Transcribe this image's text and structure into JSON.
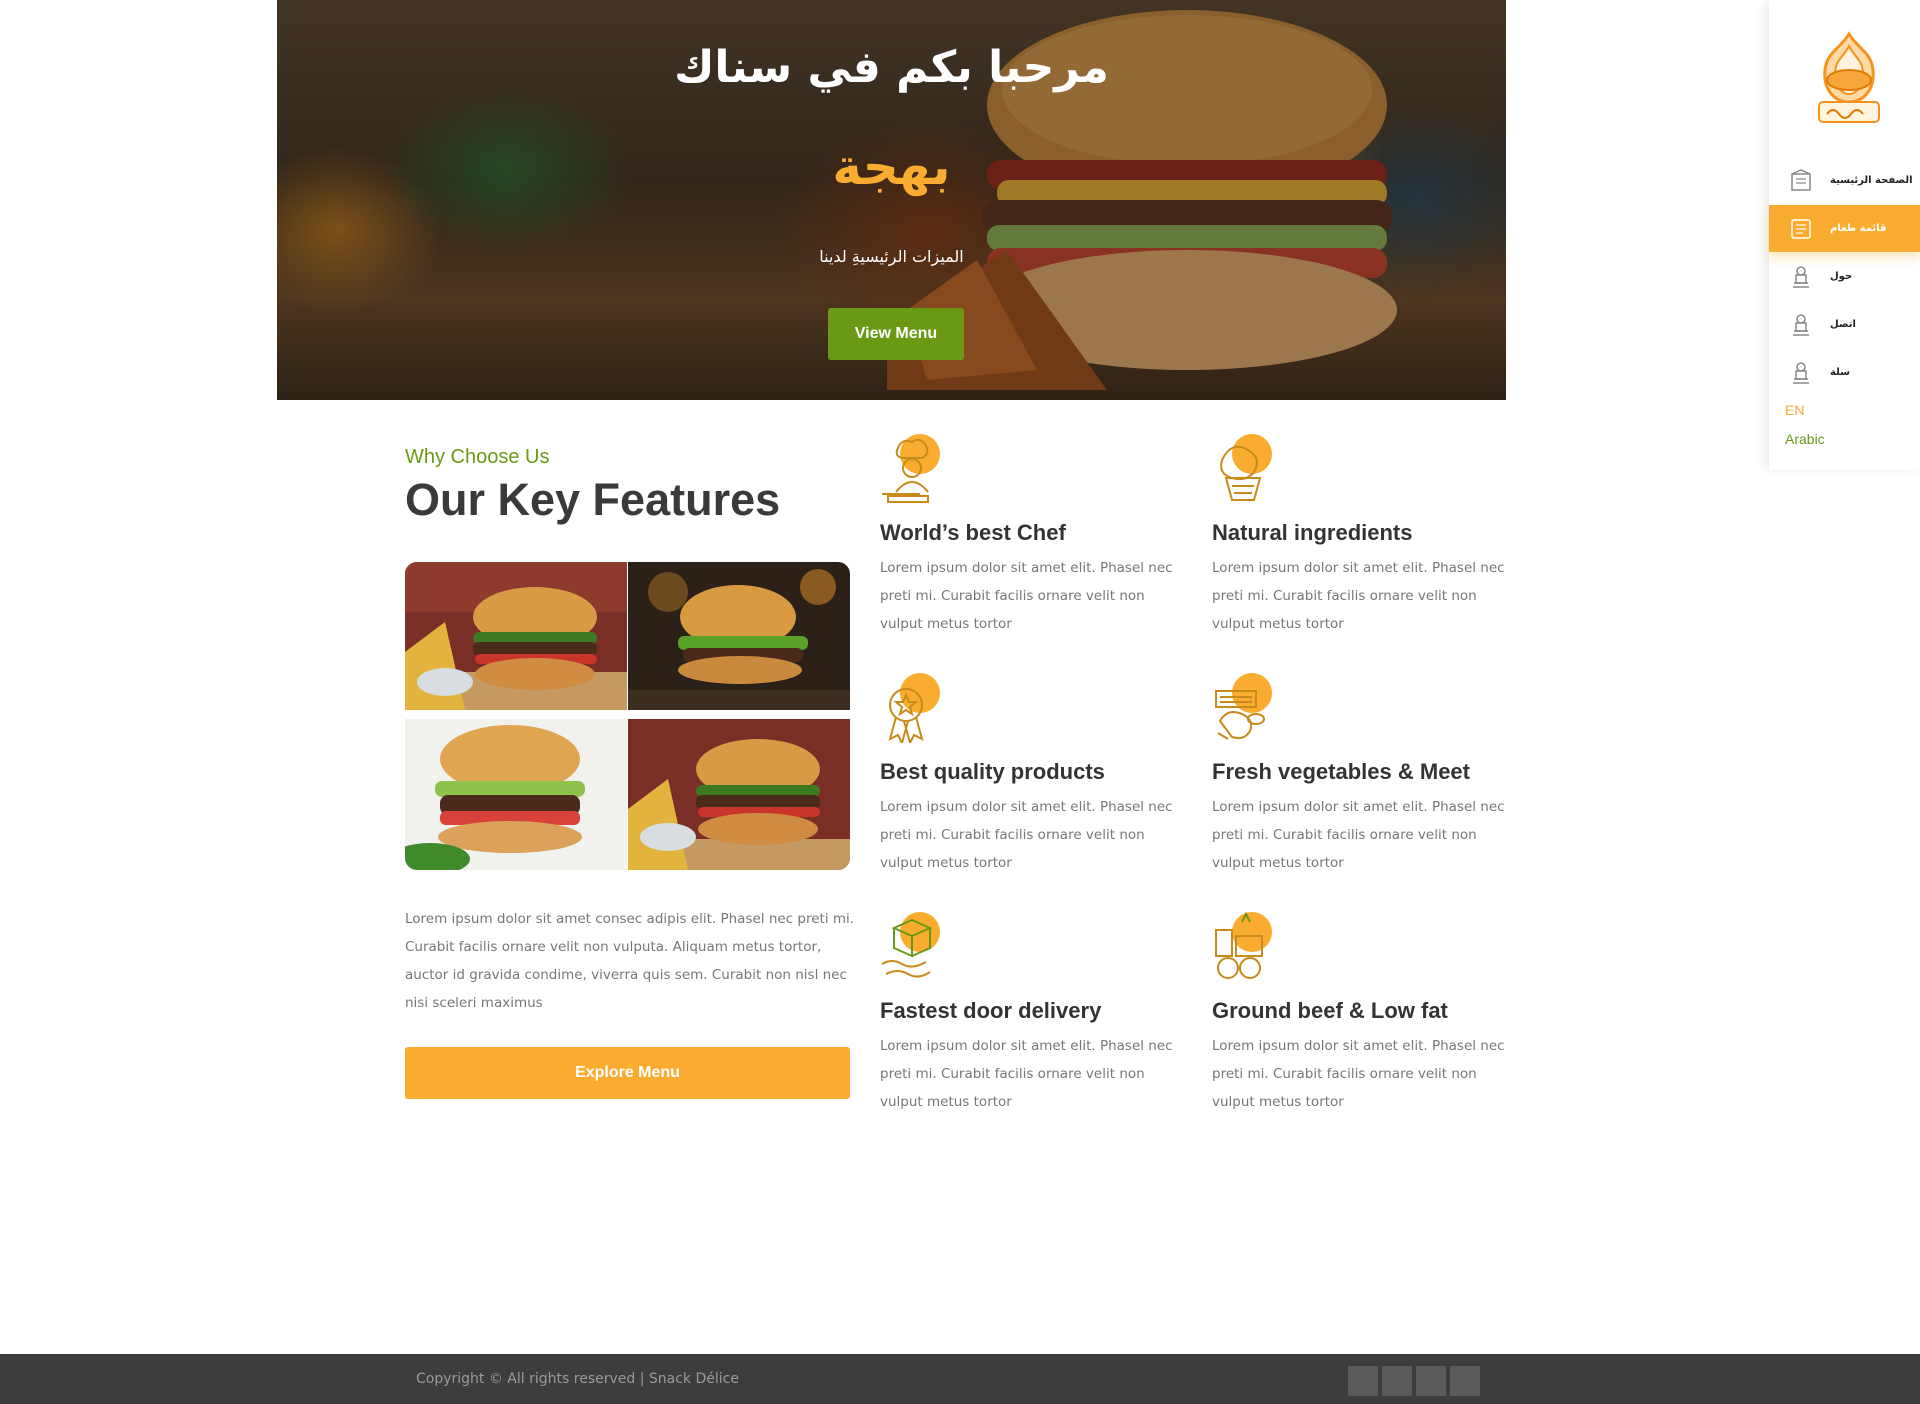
{
  "hero": {
    "title": "مرحبا بكم في سناك",
    "accent": "بهجة",
    "subtitle": "الميزات الرئيسيةِ لدينا",
    "button_label": "View Menu"
  },
  "sidebar": {
    "items": [
      {
        "label": "الصفحة الرئيسية",
        "icon": "home-icon",
        "active": false
      },
      {
        "label": "قائمة طعام",
        "icon": "menu-board-icon",
        "active": true
      },
      {
        "label": "حول",
        "icon": "chef-icon",
        "active": false
      },
      {
        "label": "اتصل",
        "icon": "chef-icon",
        "active": false
      },
      {
        "label": "سلة",
        "icon": "chef-icon",
        "active": false
      }
    ],
    "languages": [
      {
        "label": "EN",
        "color": "#f9ac2f"
      },
      {
        "label": "Arabic",
        "color": "#6a9a15"
      }
    ]
  },
  "features_section": {
    "eyebrow": "Why Choose Us",
    "title": "Our Key Features",
    "intro": "Lorem ipsum dolor sit amet consec adipis elit. Phasel nec preti mi. Curabit facilis ornare velit non vulputa. Aliquam metus tortor, auctor id gravida condime, viverra quis sem. Curabit non nisl nec nisi sceleri maximus",
    "button_label": "Explore Menu",
    "features": [
      {
        "title": "World’s best Chef",
        "description": "Lorem ipsum dolor sit amet elit. Phasel nec preti mi. Curabit facilis ornare velit non vulput metus tortor",
        "icon": "chef-icon"
      },
      {
        "title": "Natural ingredients",
        "description": "Lorem ipsum dolor sit amet elit. Phasel nec preti mi. Curabit facilis ornare velit non vulput metus tortor",
        "icon": "vegetables-icon"
      },
      {
        "title": "Best quality products",
        "description": "Lorem ipsum dolor sit amet elit. Phasel nec preti mi. Curabit facilis ornare velit non vulput metus tortor",
        "icon": "quality-badge-icon"
      },
      {
        "title": "Fresh vegetables & Meet",
        "description": "Lorem ipsum dolor sit amet elit. Phasel nec preti mi. Curabit facilis ornare velit non vulput metus tortor",
        "icon": "meat-icon"
      },
      {
        "title": "Fastest door delivery",
        "description": "Lorem ipsum dolor sit amet elit. Phasel nec preti mi. Curabit facilis ornare velit non vulput metus tortor",
        "icon": "delivery-box-icon"
      },
      {
        "title": "Ground beef & Low fat",
        "description": "Lorem ipsum dolor sit amet elit. Phasel nec preti mi. Curabit facilis ornare velit non vulput metus tortor",
        "icon": "grocery-icon"
      }
    ]
  },
  "footer": {
    "copyright": "Copyright © All rights reserved | Snack Délice"
  },
  "colors": {
    "accent": "#f9ac2f",
    "green": "#6a9a15",
    "footer": "#3d3d3d"
  }
}
